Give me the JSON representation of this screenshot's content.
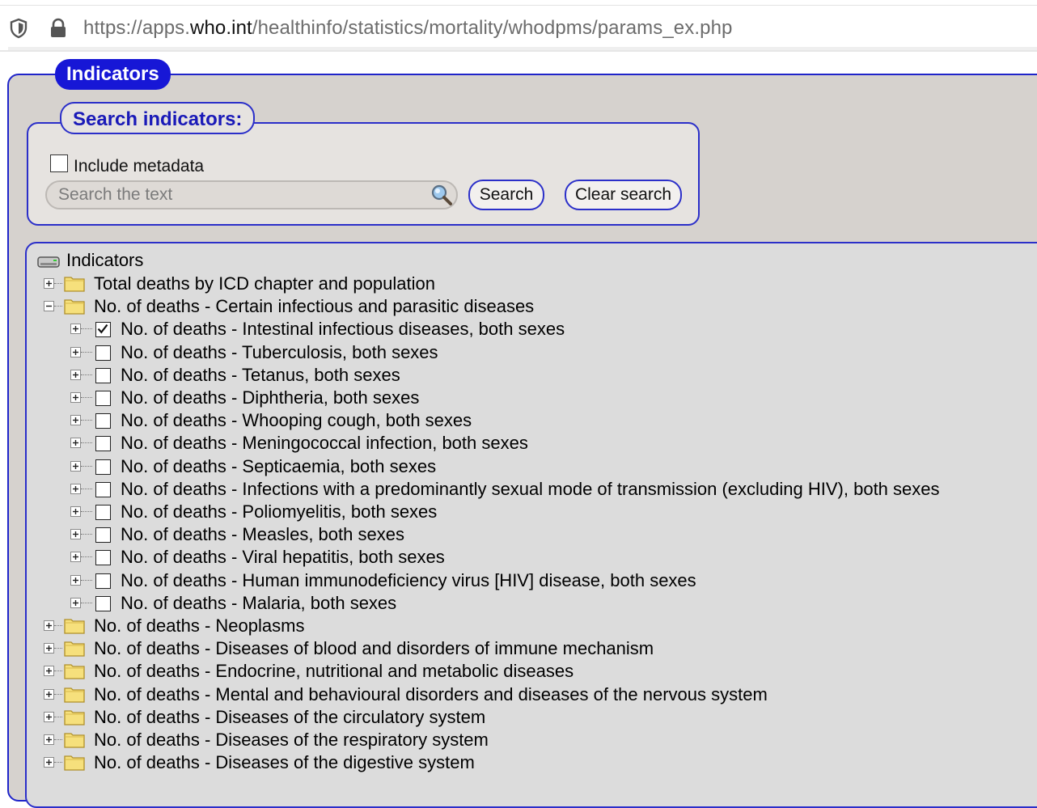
{
  "browser": {
    "url_prefix": "https://apps.",
    "url_host": "who.int",
    "url_path": "/healthinfo/statistics/mortality/whodpms/params_ex.php"
  },
  "panel": {
    "legend": "Indicators"
  },
  "search": {
    "legend": "Search indicators:",
    "include_metadata_label": "Include metadata",
    "include_metadata_checked": false,
    "input_placeholder": "Search the text",
    "input_value": "",
    "search_button": "Search",
    "clear_button": "Clear search"
  },
  "tree": {
    "root_label": "Indicators",
    "chapters": [
      {
        "label": "Total deaths by ICD chapter and population",
        "expanded": false
      },
      {
        "label": "No. of deaths - Certain infectious and parasitic diseases",
        "expanded": true,
        "children": [
          {
            "label": "No. of deaths - Intestinal infectious diseases, both sexes",
            "checked": true
          },
          {
            "label": "No. of deaths - Tuberculosis, both sexes",
            "checked": false
          },
          {
            "label": "No. of deaths - Tetanus, both sexes",
            "checked": false
          },
          {
            "label": "No. of deaths - Diphtheria, both sexes",
            "checked": false
          },
          {
            "label": "No. of deaths - Whooping cough, both sexes",
            "checked": false
          },
          {
            "label": "No. of deaths - Meningococcal infection, both sexes",
            "checked": false
          },
          {
            "label": "No. of deaths - Septicaemia, both sexes",
            "checked": false
          },
          {
            "label": "No. of deaths - Infections with a predominantly sexual mode of transmission (excluding HIV), both sexes",
            "checked": false
          },
          {
            "label": "No. of deaths - Poliomyelitis, both sexes",
            "checked": false
          },
          {
            "label": "No. of deaths - Measles, both sexes",
            "checked": false
          },
          {
            "label": "No. of deaths - Viral hepatitis, both sexes",
            "checked": false
          },
          {
            "label": "No. of deaths - Human immunodeficiency virus [HIV] disease, both sexes",
            "checked": false
          },
          {
            "label": "No. of deaths - Malaria, both sexes",
            "checked": false
          }
        ]
      },
      {
        "label": "No. of deaths - Neoplasms",
        "expanded": false
      },
      {
        "label": "No. of deaths - Diseases of blood and disorders of immune mechanism",
        "expanded": false
      },
      {
        "label": "No. of deaths - Endocrine, nutritional and metabolic diseases",
        "expanded": false
      },
      {
        "label": "No. of deaths - Mental and behavioural disorders and diseases of the nervous system",
        "expanded": false
      },
      {
        "label": "No. of deaths - Diseases of the circulatory system",
        "expanded": false
      },
      {
        "label": "No. of deaths - Diseases of the respiratory system",
        "expanded": false
      },
      {
        "label": "No. of deaths - Diseases of the digestive system",
        "expanded": false
      }
    ]
  },
  "colors": {
    "accent_blue": "#1717d6",
    "panel_bg": "#d6d2ce",
    "tree_bg": "#dcdcdc",
    "folder_yellow": "#f5e27a"
  }
}
